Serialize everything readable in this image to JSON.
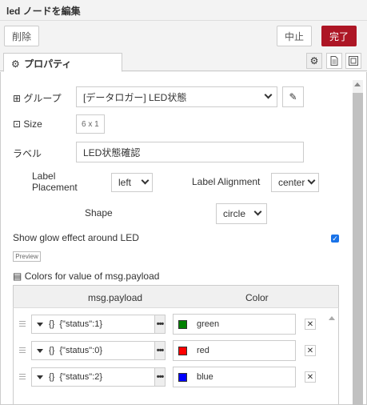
{
  "dialog": {
    "title": "led ノードを編集"
  },
  "toolbar": {
    "delete_label": "削除",
    "cancel_label": "中止",
    "done_label": "完了",
    "done_color": "#ad1625"
  },
  "tabs": {
    "properties_label": "プロパティ"
  },
  "form": {
    "group_label": "グループ",
    "group_value": "[データロガー] LED状態",
    "size_label": "Size",
    "size_value": "6 x 1",
    "label_label": "ラベル",
    "label_value": "LED状態確認",
    "label_placement_label": "Label Placement",
    "label_placement_value": "left",
    "label_alignment_label": "Label Alignment",
    "label_alignment_value": "center",
    "shape_label": "Shape",
    "shape_value": "circle",
    "glow_label": "Show glow effect around LED",
    "glow_checked": true,
    "preview_label": "Preview",
    "colors_label": "Colors for value of msg.payload"
  },
  "colors_table": {
    "headers": [
      "msg.payload",
      "Color"
    ],
    "rows": [
      {
        "type_icon": "{}",
        "value": "{\"status\":1}",
        "color_name": "green",
        "color_hex": "#008000"
      },
      {
        "type_icon": "{}",
        "value": "{\"status\":0}",
        "color_name": "red",
        "color_hex": "#ff0000"
      },
      {
        "type_icon": "{}",
        "value": "{\"status\":2}",
        "color_name": "blue",
        "color_hex": "#0000ff"
      }
    ]
  }
}
